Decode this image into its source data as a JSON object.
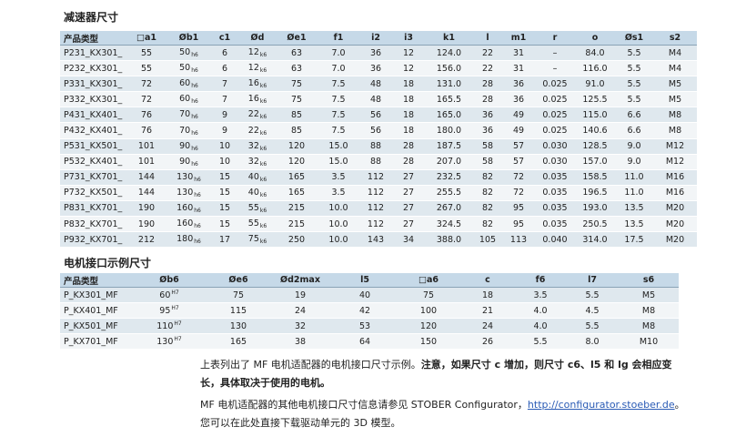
{
  "section1": {
    "title": "减速器尺寸",
    "headers": [
      "产品类型",
      "□a1",
      "Øb1",
      "c1",
      "Ød",
      "Øe1",
      "f1",
      "i2",
      "i3",
      "k1",
      "l",
      "m1",
      "r",
      "o",
      "Øs1",
      "s2"
    ],
    "rows": [
      {
        "name": "P231_KX301_",
        "a1": "55",
        "b1": "50",
        "b1sub": "h6",
        "c1": "6",
        "d": "12",
        "dsub": "k6",
        "e1": "63",
        "f1": "7.0",
        "i2": "36",
        "i3": "12",
        "k1": "124.0",
        "l": "22",
        "m1": "31",
        "r": "–",
        "o": "84.0",
        "s1": "5.5",
        "s2": "M4"
      },
      {
        "name": "P232_KX301_",
        "a1": "55",
        "b1": "50",
        "b1sub": "h6",
        "c1": "6",
        "d": "12",
        "dsub": "k6",
        "e1": "63",
        "f1": "7.0",
        "i2": "36",
        "i3": "12",
        "k1": "156.0",
        "l": "22",
        "m1": "31",
        "r": "–",
        "o": "116.0",
        "s1": "5.5",
        "s2": "M4"
      },
      {
        "name": "P331_KX301_",
        "a1": "72",
        "b1": "60",
        "b1sub": "h6",
        "c1": "7",
        "d": "16",
        "dsub": "k6",
        "e1": "75",
        "f1": "7.5",
        "i2": "48",
        "i3": "18",
        "k1": "131.0",
        "l": "28",
        "m1": "36",
        "r": "0.025",
        "o": "91.0",
        "s1": "5.5",
        "s2": "M5"
      },
      {
        "name": "P332_KX301_",
        "a1": "72",
        "b1": "60",
        "b1sub": "h6",
        "c1": "7",
        "d": "16",
        "dsub": "k6",
        "e1": "75",
        "f1": "7.5",
        "i2": "48",
        "i3": "18",
        "k1": "165.5",
        "l": "28",
        "m1": "36",
        "r": "0.025",
        "o": "125.5",
        "s1": "5.5",
        "s2": "M5"
      },
      {
        "name": "P431_KX401_",
        "a1": "76",
        "b1": "70",
        "b1sub": "h6",
        "c1": "9",
        "d": "22",
        "dsub": "k6",
        "e1": "85",
        "f1": "7.5",
        "i2": "56",
        "i3": "18",
        "k1": "165.0",
        "l": "36",
        "m1": "49",
        "r": "0.025",
        "o": "115.0",
        "s1": "6.6",
        "s2": "M8"
      },
      {
        "name": "P432_KX401_",
        "a1": "76",
        "b1": "70",
        "b1sub": "h6",
        "c1": "9",
        "d": "22",
        "dsub": "k6",
        "e1": "85",
        "f1": "7.5",
        "i2": "56",
        "i3": "18",
        "k1": "180.0",
        "l": "36",
        "m1": "49",
        "r": "0.025",
        "o": "140.6",
        "s1": "6.6",
        "s2": "M8"
      },
      {
        "name": "P531_KX501_",
        "a1": "101",
        "b1": "90",
        "b1sub": "h6",
        "c1": "10",
        "d": "32",
        "dsub": "k6",
        "e1": "120",
        "f1": "15.0",
        "i2": "88",
        "i3": "28",
        "k1": "187.5",
        "l": "58",
        "m1": "57",
        "r": "0.030",
        "o": "128.5",
        "s1": "9.0",
        "s2": "M12"
      },
      {
        "name": "P532_KX401_",
        "a1": "101",
        "b1": "90",
        "b1sub": "h6",
        "c1": "10",
        "d": "32",
        "dsub": "k6",
        "e1": "120",
        "f1": "15.0",
        "i2": "88",
        "i3": "28",
        "k1": "207.0",
        "l": "58",
        "m1": "57",
        "r": "0.030",
        "o": "157.0",
        "s1": "9.0",
        "s2": "M12"
      },
      {
        "name": "P731_KX701_",
        "a1": "144",
        "b1": "130",
        "b1sub": "h6",
        "c1": "15",
        "d": "40",
        "dsub": "k6",
        "e1": "165",
        "f1": "3.5",
        "i2": "112",
        "i3": "27",
        "k1": "232.5",
        "l": "82",
        "m1": "72",
        "r": "0.035",
        "o": "158.5",
        "s1": "11.0",
        "s2": "M16"
      },
      {
        "name": "P732_KX501_",
        "a1": "144",
        "b1": "130",
        "b1sub": "h6",
        "c1": "15",
        "d": "40",
        "dsub": "k6",
        "e1": "165",
        "f1": "3.5",
        "i2": "112",
        "i3": "27",
        "k1": "255.5",
        "l": "82",
        "m1": "72",
        "r": "0.035",
        "o": "196.5",
        "s1": "11.0",
        "s2": "M16"
      },
      {
        "name": "P831_KX701_",
        "a1": "190",
        "b1": "160",
        "b1sub": "h6",
        "c1": "15",
        "d": "55",
        "dsub": "k6",
        "e1": "215",
        "f1": "10.0",
        "i2": "112",
        "i3": "27",
        "k1": "267.0",
        "l": "82",
        "m1": "95",
        "r": "0.035",
        "o": "193.0",
        "s1": "13.5",
        "s2": "M20"
      },
      {
        "name": "P832_KX701_",
        "a1": "190",
        "b1": "160",
        "b1sub": "h6",
        "c1": "15",
        "d": "55",
        "dsub": "k6",
        "e1": "215",
        "f1": "10.0",
        "i2": "112",
        "i3": "27",
        "k1": "324.5",
        "l": "82",
        "m1": "95",
        "r": "0.035",
        "o": "250.5",
        "s1": "13.5",
        "s2": "M20"
      },
      {
        "name": "P932_KX701_",
        "a1": "212",
        "b1": "180",
        "b1sub": "h6",
        "c1": "17",
        "d": "75",
        "dsub": "k6",
        "e1": "250",
        "f1": "10.0",
        "i2": "143",
        "i3": "34",
        "k1": "388.0",
        "l": "105",
        "m1": "113",
        "r": "0.040",
        "o": "314.0",
        "s1": "17.5",
        "s2": "M20"
      }
    ]
  },
  "section2": {
    "title": "电机接口示例尺寸",
    "headers": [
      "产品类型",
      "Øb6",
      "Øe6",
      "Ød2max",
      "l5",
      "□a6",
      "c",
      "f6",
      "l7",
      "s6"
    ],
    "rows": [
      {
        "name": "P_KX301_MF",
        "b6": "60",
        "b6sup": "H7",
        "e6": "75",
        "d2max": "19",
        "l5": "40",
        "a6": "75",
        "c": "18",
        "f6": "3.5",
        "l7": "5.5",
        "s6": "M5"
      },
      {
        "name": "P_KX401_MF",
        "b6": "95",
        "b6sup": "H7",
        "e6": "115",
        "d2max": "24",
        "l5": "42",
        "a6": "100",
        "c": "21",
        "f6": "4.0",
        "l7": "4.5",
        "s6": "M8"
      },
      {
        "name": "P_KX501_MF",
        "b6": "110",
        "b6sup": "H7",
        "e6": "130",
        "d2max": "32",
        "l5": "53",
        "a6": "120",
        "c": "24",
        "f6": "4.0",
        "l7": "5.5",
        "s6": "M8"
      },
      {
        "name": "P_KX701_MF",
        "b6": "130",
        "b6sup": "H7",
        "e6": "165",
        "d2max": "38",
        "l5": "64",
        "a6": "150",
        "c": "26",
        "f6": "5.5",
        "l7": "8.0",
        "s6": "M10"
      }
    ]
  },
  "note": {
    "p1_normal": "上表列出了 MF 电机适配器的电机接口尺寸示例。",
    "p1_bold": "注意，如果尺寸 c 增加，则尺寸 c6、l5 和 lg 会相应变长，具体取决于使用的电机。",
    "p2_before": "MF 电机适配器的其他电机接口尺寸信息请参见 STOBER Configurator，",
    "p2_link": "http://configurator.stoeber.de",
    "p2_after": "。您可以在此处直接下载驱动单元的 3D 模型。"
  },
  "colors": {
    "header_bg": "#c6d9e8",
    "row_alt": "#dfe8ee",
    "row_base": "#f2f5f7",
    "link": "#2a5bb5"
  }
}
